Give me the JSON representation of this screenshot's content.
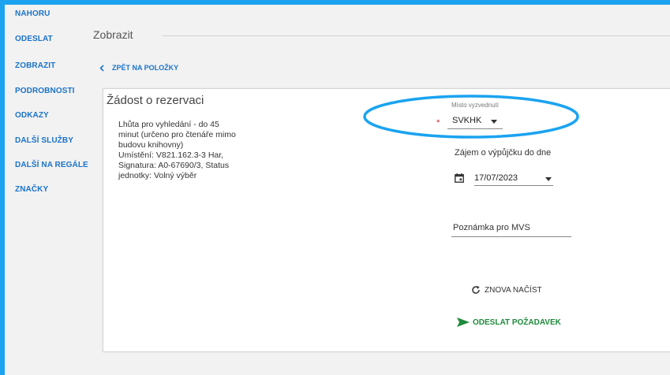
{
  "sidebar": {
    "items": [
      {
        "label": "NAHORU"
      },
      {
        "label": "ODESLAT"
      },
      {
        "label": "ZOBRAZIT"
      },
      {
        "label": "PODROBNOSTI"
      },
      {
        "label": "ODKAZY"
      },
      {
        "label": "DALŠÍ SLUŽBY"
      },
      {
        "label": "DALŠÍ NA REGÁLE"
      },
      {
        "label": "ZNAČKY"
      }
    ]
  },
  "header": {
    "title": "Zobrazit"
  },
  "back_link": {
    "label": "ZPĚT NA POLOŽKY",
    "icon": "chevron-left-icon"
  },
  "request": {
    "title": "Žádost o rezervaci",
    "info": "Lhůta pro vyhledání - do 45\nminut (určeno pro čtenáře mimo\nbudovu knihovny)\nUmístění: V821.162.3-3 Har,\nSignatura: A0-67690/3,  Status\njednotky: Volný výběr",
    "pickup": {
      "label": "Místo vyzvednutí",
      "value": "SVKHK",
      "required_mark": "*"
    },
    "interest_date": {
      "label": "Zájem o výpůjčku do dne",
      "value": "17/07/2023",
      "icon": "calendar-icon"
    },
    "note": {
      "placeholder": "Poznámka pro MVS",
      "value": ""
    },
    "reload_button": {
      "label": "ZNOVA NAČÍST",
      "icon": "refresh-icon"
    },
    "submit_button": {
      "label": "ODESLAT POŽADAVEK",
      "icon": "send-icon"
    }
  },
  "colors": {
    "frame_border": "#1ba3f0",
    "link": "#1a73c9",
    "submit": "#1e8a3a",
    "required": "#e02020",
    "highlight": "#1ba3f0"
  }
}
